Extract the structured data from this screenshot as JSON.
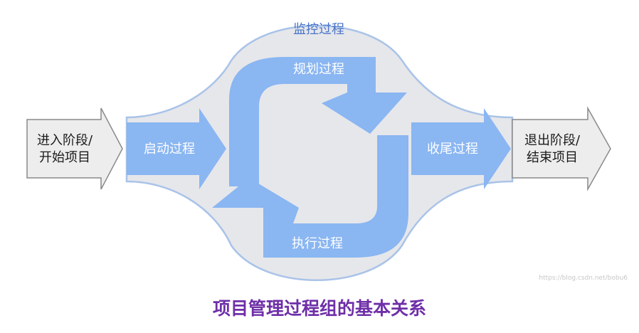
{
  "diagram": {
    "monitor_label": "监控过程",
    "planning_label": "规划过程",
    "initiating_label": "启动过程",
    "executing_label": "执行过程",
    "closing_label": "收尾过程",
    "enter": {
      "line1": "进入阶段/",
      "line2": "开始项目"
    },
    "exit": {
      "line1": "退出阶段/",
      "line2": "结束项目"
    },
    "watermark": "https://blog.csdn.net/bobu6"
  },
  "caption": "项目管理过程组的基本关系",
  "colors": {
    "process_blue": "#8ab6f2",
    "monitor_fill": "#e6e7eb",
    "monitor_stroke": "#a9c3e8",
    "io_fill": "#ededed",
    "io_stroke": "#8a8a8a",
    "caption": "#6e2fa8"
  }
}
